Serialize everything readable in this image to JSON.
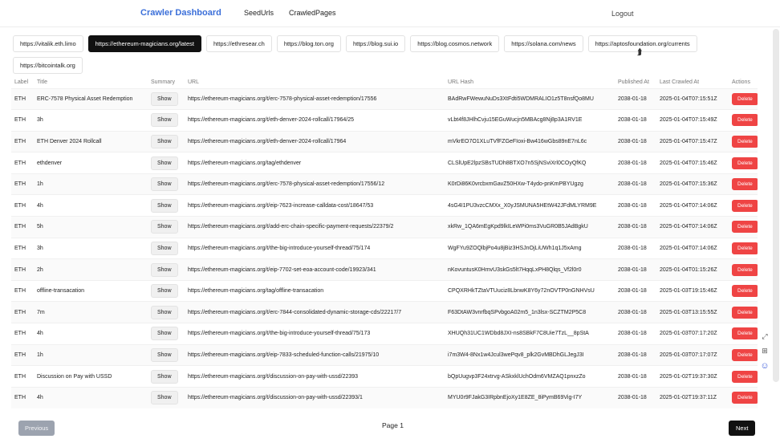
{
  "header": {
    "brand": "Crawler Dashboard",
    "nav": [
      "SeedUrls",
      "CrawledPages"
    ],
    "logout": "Logout"
  },
  "tabs": [
    "https://vitalik.eth.limo",
    "https://ethereum-magicians.org/latest",
    "https://ethresear.ch",
    "https://blog.ton.org",
    "https://blog.sui.io",
    "https://blog.cosmos.network",
    "https://solana.com/news",
    "https://aptosfoundation.org/currents",
    "https://bitcointalk.org"
  ],
  "active_tab": 1,
  "table": {
    "columns": [
      "Label",
      "Title",
      "Summary",
      "URL",
      "URL Hash",
      "Published At",
      "Last Crawled At",
      "Actions"
    ],
    "show_label": "Show",
    "delete_label": "Delete",
    "rows": [
      [
        "ETH",
        "ERC-7578 Physical Asset Redemption",
        "https://ethereum-magicians.org/t/erc-7578-physical-asset-redemption/17556",
        "BAdRwFWewuNuDs3XtFdti5WDMRALIO1z5T8nsfQo8MU",
        "2038-01-18",
        "2025-01-04T07:15:51Z"
      ],
      [
        "ETH",
        "3h",
        "https://ethereum-magicians.org/t/eth-denver-2024-rollcall/17964/25",
        "vLbt4f8JHlhCvju15EGuWucjn5MBAcg8Nj8p3A1RV1E",
        "2038-01-18",
        "2025-01-04T07:15:49Z"
      ],
      [
        "ETH",
        "ETH Denver 2024 Rollcall",
        "https://ethereum-magicians.org/t/eth-denver-2024-rollcall/17964",
        "mVkrEO7O1XLuTVfFZGeFIoxi-Bw416wGbs89nE7nL6c",
        "2038-01-18",
        "2025-01-04T07:15:47Z"
      ],
      [
        "ETH",
        "ethdenver",
        "https://ethereum-magicians.org/tag/ethdenver",
        "CLSlUpE2lpzSBsTUDh8BTXO7n5SjNSviXrl0COyQfKQ",
        "2038-01-18",
        "2025-01-04T07:15:46Z"
      ],
      [
        "ETH",
        "1h",
        "https://ethereum-magicians.org/t/erc-7578-physical-asset-redemption/17556/12",
        "K0rDi86K0vrcbxmGavZ50HXw-T4ydo-pnKmPBYUgzg",
        "2038-01-18",
        "2025-01-04T07:15:36Z"
      ],
      [
        "ETH",
        "4h",
        "https://ethereum-magicians.org/t/eip-7623-increase-calldata-cost/18647/53",
        "4sG4I1PU3vzcCMXx_X0yJSMUNA5HEtW42JFdMLYRM9E",
        "2038-01-18",
        "2025-01-04T07:14:06Z"
      ],
      [
        "ETH",
        "5h",
        "https://ethereum-magicians.org/t/add-erc-chain-specific-payment-requests/22379/2",
        "xkRw_1QA6mEgKpd9lkILeWPi0ms3VuGR0B5JAdBgkU",
        "2038-01-18",
        "2025-01-04T07:14:06Z"
      ],
      [
        "ETH",
        "3h",
        "https://ethereum-magicians.org/t/the-big-introduce-yourself-thread/75/174",
        "WgFYu9ZOQlbjPo4u8jBiz3HSJnOjLiUWh1q1J5xAmg",
        "2038-01-18",
        "2025-01-04T07:14:06Z"
      ],
      [
        "ETH",
        "2h",
        "https://ethereum-magicians.org/t/eip-7702-set-eoa-account-code/19923/341",
        "nKovuntusK0HmvU3skGs5lt7HqqLxPH8Qlqs_Vf2l0r0",
        "2038-01-18",
        "2025-01-04T01:15:26Z"
      ],
      [
        "ETH",
        "offline-transacation",
        "https://ethereum-magicians.org/tag/offline-transacation",
        "CPQXRHkTZtaVTUuciz8LbnwK8Y6y72nOVTP0nGNHVsU",
        "2038-01-18",
        "2025-01-03T19:15:46Z"
      ],
      [
        "ETH",
        "7m",
        "https://ethereum-magicians.org/t/erc-7844-consolidated-dynamic-storage-cds/22217/7",
        "F63DtAW3vnrfbqSPvbgoA02m5_1n3lsx-SCZTM2P5C8",
        "2038-01-18",
        "2025-01-03T13:15:55Z"
      ],
      [
        "ETH",
        "4h",
        "https://ethereum-magicians.org/t/the-big-introduce-yourself-thread/75/173",
        "XHUQh31UC1WDbd8JXI-ns8SBkF7C8Uie7TzL__8pStA",
        "2038-01-18",
        "2025-01-03T07:17:20Z"
      ],
      [
        "ETH",
        "1h",
        "https://ethereum-magicians.org/t/eip-7833-scheduled-function-calls/21975/10",
        "i7m3W4-8Nx1w4Jcul3wePqv8_plk2GvMBDhGLJegJ3I",
        "2038-01-18",
        "2025-01-03T07:17:07Z"
      ],
      [
        "ETH",
        "Discussion on Pay with USSD",
        "https://ethereum-magicians.org/t/discussion-on-pay-with-ussd/22393",
        "bQpUugvp3F24xtrvg-ASkxklUchOdm6VMZAQ1pnxzZo",
        "2038-01-18",
        "2025-01-02T19:37:30Z"
      ],
      [
        "ETH",
        "4h",
        "https://ethereum-magicians.org/t/discussion-on-pay-with-ussd/22393/1",
        "MYU0r9FJakG3IRpbnEjoXy1E8ZE_8iPymB69Vig-I7Y",
        "2038-01-18",
        "2025-01-02T19:37:11Z"
      ]
    ]
  },
  "pagination": {
    "prev": "Previous",
    "page": "Page 1",
    "next": "Next"
  }
}
